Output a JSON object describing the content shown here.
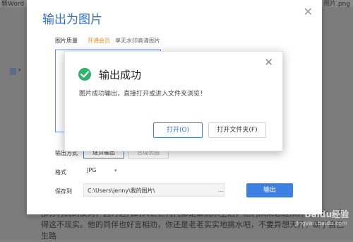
{
  "background": {
    "top_left_text": "新Word",
    "top_right_text": "图片.png",
    "text_lines": [
      "部分村民的反对，因为这几的人世世代代都是靠挑水生活，他们从未想过从外面引水，也觉",
      "得这不现实。他的同伴也好言相劝，你还是老老实实地挑水吧，不要异想天开，断了自己的",
      "生路"
    ]
  },
  "dialog": {
    "title": "输出为图片",
    "quality_label": "图片质量",
    "vip_link": "开通会员",
    "vip_desc": "享无水印高清图片",
    "method_label": "输出方式",
    "method_option1": "逐页输出",
    "method_option2": "合成长图",
    "format_label": "格式",
    "format_value": "JPG",
    "save_label": "保存到",
    "save_path": "C:\\Users\\jenny\\我的图片\\",
    "path_more": "...",
    "export_button": "输出"
  },
  "popup": {
    "title": "输出成功",
    "message": "图片成功输出，直接打开或进入文件夹浏览！",
    "open_button": "打开(O)",
    "open_folder_button": "打开文件夹(F)"
  },
  "watermark": {
    "text": "Baidu经验",
    "sub": "jingyan.baidu.com"
  },
  "colors": {
    "accent": "#2f6fd7",
    "success": "#2fb36c",
    "vip": "#f08d22"
  }
}
